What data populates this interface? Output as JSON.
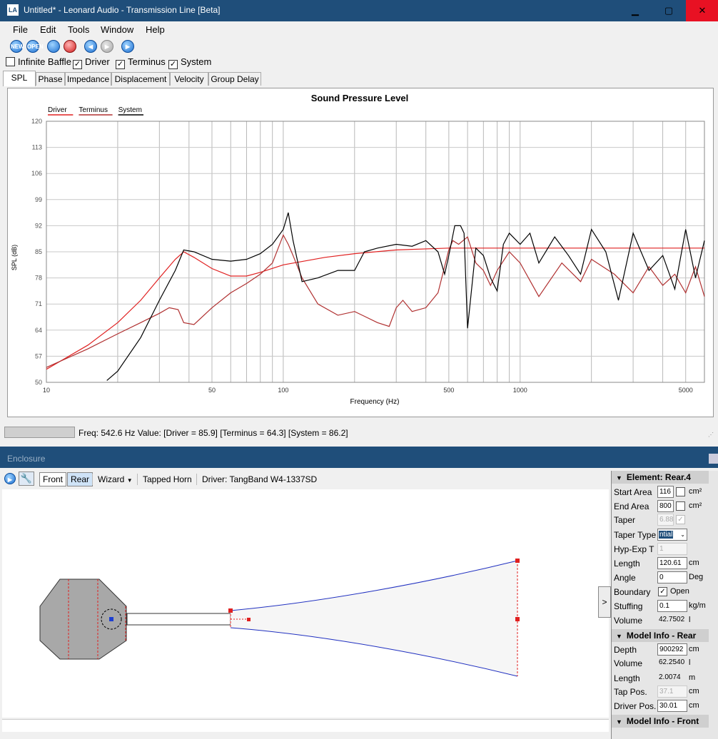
{
  "window": {
    "title": "Untitled* - Leonard Audio - Transmission Line [Beta]",
    "logo": "LA",
    "controls": {
      "minimize": "▁",
      "maximize": "▢",
      "close": "✕"
    }
  },
  "menu": [
    "File",
    "Edit",
    "Tools",
    "Window",
    "Help"
  ],
  "toolbar": {
    "icons": [
      {
        "name": "new-icon",
        "glyph": "NEW"
      },
      {
        "name": "open-icon",
        "glyph": "OPEN"
      },
      {
        "name": "record-blue-icon",
        "glyph": ""
      },
      {
        "name": "record-red-icon",
        "glyph": ""
      },
      {
        "name": "step-back-icon",
        "glyph": "◀"
      },
      {
        "name": "step-forward-icon",
        "glyph": "▶"
      },
      {
        "name": "play-icon",
        "glyph": "▶"
      }
    ]
  },
  "options": [
    {
      "label": "Infinite Baffle",
      "checked": false
    },
    {
      "label": "Driver",
      "checked": true
    },
    {
      "label": "Terminus",
      "checked": true
    },
    {
      "label": "System",
      "checked": true
    }
  ],
  "tabs": [
    "SPL",
    "Phase",
    "Impedance",
    "Displacement",
    "Velocity",
    "Group Delay"
  ],
  "status": {
    "text": "Freq: 542.6 Hz  Value: [Driver = 85.9]  [Terminus = 64.3]  [System = 86.2]"
  },
  "chart_data": {
    "type": "line",
    "title": "Sound Pressure Level",
    "xlabel": "Frequency (Hz)",
    "ylabel": "SPL (dB)",
    "x_scale": "log",
    "xlim": [
      10,
      6000
    ],
    "ylim": [
      50,
      120
    ],
    "y_ticks": [
      50,
      57,
      64,
      71,
      78,
      85,
      92,
      99,
      106,
      113,
      120
    ],
    "x_tick_labels": [
      10,
      50,
      100,
      500,
      1000,
      5000
    ],
    "grid": true,
    "legend_position": "top-left",
    "legend": [
      "Driver",
      "Terminus",
      "System"
    ],
    "colors": {
      "Driver": "#e02020",
      "Terminus": "#b03030",
      "System": "#000000"
    },
    "series": [
      {
        "name": "Driver",
        "x": [
          10,
          15,
          20,
          25,
          30,
          35,
          38,
          42,
          50,
          60,
          70,
          80,
          100,
          150,
          200,
          300,
          500,
          1000,
          2000,
          5000,
          6000
        ],
        "y": [
          53.5,
          60,
          66,
          72,
          78,
          83,
          85,
          83.5,
          80.5,
          78.5,
          78.5,
          79.5,
          81.5,
          83.5,
          84.5,
          85.5,
          86,
          86,
          86,
          86,
          86
        ]
      },
      {
        "name": "Terminus",
        "x": [
          10,
          15,
          20,
          25,
          30,
          33,
          36,
          38,
          42,
          50,
          60,
          70,
          80,
          90,
          100,
          105,
          110,
          120,
          140,
          170,
          200,
          250,
          280,
          300,
          320,
          350,
          400,
          450,
          500,
          520,
          550,
          600,
          650,
          700,
          750,
          800,
          900,
          1000,
          1200,
          1500,
          1800,
          2000,
          2500,
          3000,
          3500,
          4000,
          4500,
          5000,
          5500,
          6000
        ],
        "y": [
          54,
          59,
          63,
          66,
          68.5,
          70,
          69.5,
          66,
          65.5,
          70,
          74,
          76.5,
          79,
          82,
          89.5,
          87,
          84,
          78,
          71,
          68,
          69,
          66,
          65,
          70,
          72,
          69,
          70,
          74,
          85.5,
          88,
          87,
          89,
          82,
          80,
          76,
          80,
          85,
          82,
          73,
          82,
          77,
          83,
          79,
          74,
          81,
          76,
          79,
          74,
          81,
          73
        ]
      },
      {
        "name": "System",
        "x": [
          18,
          20,
          25,
          30,
          35,
          38,
          42,
          50,
          60,
          70,
          80,
          90,
          100,
          105,
          110,
          120,
          140,
          170,
          200,
          220,
          250,
          300,
          350,
          400,
          450,
          480,
          500,
          530,
          560,
          580,
          600,
          650,
          700,
          750,
          800,
          850,
          900,
          1000,
          1100,
          1200,
          1400,
          1600,
          1800,
          2000,
          2300,
          2600,
          3000,
          3500,
          4000,
          4500,
          5000,
          5500,
          6000
        ],
        "y": [
          50.5,
          53,
          62,
          72,
          80,
          85.5,
          85,
          83,
          82.5,
          83,
          84.5,
          87,
          91,
          95.5,
          88,
          77,
          78,
          80,
          80,
          85,
          86,
          87,
          86.5,
          88,
          85,
          79,
          84,
          92,
          92,
          90,
          64.5,
          86,
          84,
          78,
          74.5,
          87,
          90,
          87,
          90,
          82,
          89,
          84,
          79,
          91,
          85,
          72,
          90,
          80,
          84,
          75,
          91,
          78,
          88
        ]
      }
    ]
  },
  "enclosure": {
    "title": "Enclosure",
    "toolbar": {
      "front": "Front",
      "rear": "Rear",
      "wizard": "Wizard",
      "tapped_horn": "Tapped Horn",
      "driver": "Driver: TangBand W4-1337SD"
    },
    "canvas_tab": ">",
    "sections": {
      "element": {
        "header": "Element: Rear.4",
        "start_area": {
          "label": "Start Area",
          "value": "116",
          "unit": "cm²"
        },
        "end_area": {
          "label": "End Area",
          "value": "800",
          "unit": "cm²"
        },
        "taper": {
          "label": "Taper",
          "value": "6.88"
        },
        "taper_type": {
          "label": "Taper Type",
          "value": "ntial"
        },
        "hyp_exp": {
          "label": "Hyp-Exp T",
          "value": "1"
        },
        "length": {
          "label": "Length",
          "value": "120.61",
          "unit": "cm"
        },
        "angle": {
          "label": "Angle",
          "value": "0",
          "unit": "Deg"
        },
        "boundary": {
          "label": "Boundary",
          "value": "Open"
        },
        "stuffing": {
          "label": "Stuffing",
          "value": "0.1",
          "unit": "kg/m"
        },
        "volume": {
          "label": "Volume",
          "value": "42.7502",
          "unit": "l"
        }
      },
      "rear": {
        "header": "Model Info - Rear",
        "depth": {
          "label": "Depth",
          "value": "900292",
          "unit": "cm"
        },
        "volume": {
          "label": "Volume",
          "value": "62.2540",
          "unit": "l"
        },
        "length": {
          "label": "Length",
          "value": "2.0074",
          "unit": "m"
        },
        "tap_pos": {
          "label": "Tap Pos.",
          "value": "37.1",
          "unit": "cm"
        },
        "driver_pos": {
          "label": "Driver Pos.",
          "value": "30.01",
          "unit": "cm"
        }
      },
      "front": {
        "header": "Model Info - Front"
      }
    }
  }
}
